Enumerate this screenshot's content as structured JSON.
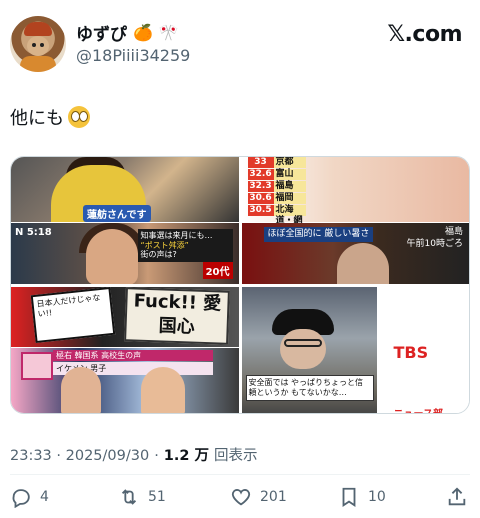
{
  "header": {
    "display_name": "ゆずぴ",
    "name_emojis": [
      "🍊",
      "🎌"
    ],
    "handle": "@18Piiii34259",
    "source": "𝕏.com"
  },
  "tweet": {
    "text": "他にも"
  },
  "media": {
    "tile1": {
      "caption_top": "蓮舫さんです",
      "time": "N 5:18",
      "ticker_line1": "知事選は来月にも…",
      "ticker_line2": "“ポスト舛添”",
      "ticker_line3": "街の声は?",
      "tag": "20代"
    },
    "tile2": {
      "temps": [
        {
          "value": "33",
          "city": "京都"
        },
        {
          "value": "32.6",
          "city": "富山"
        },
        {
          "value": "32.3",
          "city": "福島"
        },
        {
          "value": "30.6",
          "city": "福岡"
        },
        {
          "value": "30.5",
          "city": "北海道・網走"
        }
      ],
      "caption": "ほぼ全国的に 厳しい暑さ",
      "location": "福島",
      "location_time": "午前10時ごろ"
    },
    "tile3": {
      "sign_left": "日本人だけじゃない!!",
      "sign_right": "Fuck!! 愛国心",
      "ticker": "極右 韓国系 高校生の声",
      "ticker_sub": "イケメン 男子"
    },
    "tile4": {
      "caption": "安全面では やっぱりちょっと信頼というか もてないかな…",
      "logo": "TBS",
      "logo_sub": "ニュース部"
    }
  },
  "meta": {
    "timestamp": "23:33 · 2025/09/30",
    "separator": "·",
    "views_count": "1.2 万",
    "views_label": "回表示"
  },
  "actions": {
    "reply_count": "4",
    "retweet_count": "51",
    "like_count": "201",
    "bookmark_count": "10"
  },
  "icons": [
    "reply-icon",
    "retweet-icon",
    "like-icon",
    "bookmark-icon",
    "share-icon",
    "eyes-emoji-icon"
  ]
}
